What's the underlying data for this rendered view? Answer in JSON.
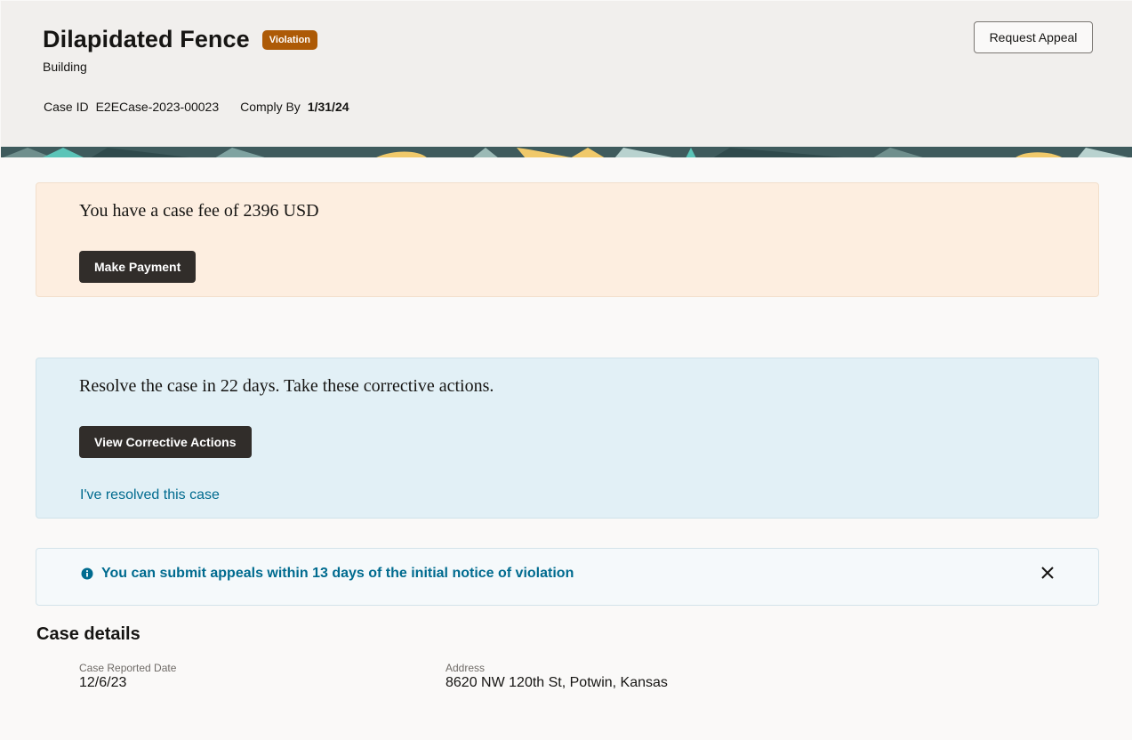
{
  "header": {
    "title": "Dilapidated Fence",
    "badge": "Violation",
    "subtitle": "Building",
    "case_id_label": "Case ID",
    "case_id_value": "E2ECase-2023-00023",
    "comply_by_label": "Comply By",
    "comply_by_value": "1/31/24",
    "request_appeal_label": "Request Appeal"
  },
  "fee_card": {
    "message": "You have a case fee of 2396 USD",
    "button_label": "Make Payment"
  },
  "resolve_card": {
    "message": "Resolve the case in 22 days. Take these corrective actions.",
    "button_label": "View Corrective Actions",
    "link_label": "I've resolved this case"
  },
  "info_card": {
    "message": "You can submit appeals within 13 days of the initial notice of violation",
    "icon": "info-icon",
    "close_icon": "close-icon"
  },
  "case_details": {
    "title": "Case details",
    "fields": [
      {
        "label": "Case Reported Date",
        "value": "12/6/23"
      },
      {
        "label": "Address",
        "value": "8620 NW 120th St, Potwin, Kansas"
      }
    ]
  },
  "colors": {
    "badge": "#ad5a06",
    "fee_bg": "#fdeee0",
    "resolve_bg": "#e2f0f6",
    "info_text": "#006b8f",
    "dark_button": "#312d2a"
  }
}
